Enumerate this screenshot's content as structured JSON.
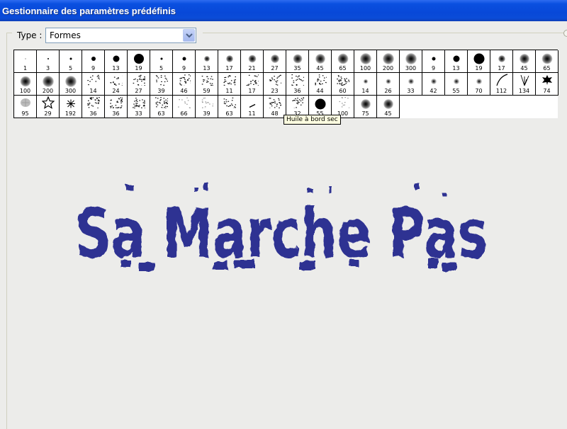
{
  "window": {
    "title": "Gestionnaire des paramètres prédéfinis"
  },
  "type_selector": {
    "label": "Type :",
    "value": "Formes"
  },
  "tooltip": "Huile à bord sec",
  "colors": {
    "title_bar": "#0A50E0",
    "art_blue": "#2E3192"
  },
  "art_text": "Sa Marche Pas",
  "brushes": [
    {
      "size": "1",
      "kind": "hard",
      "d": 1
    },
    {
      "size": "3",
      "kind": "hard",
      "d": 2
    },
    {
      "size": "5",
      "kind": "hard",
      "d": 3
    },
    {
      "size": "9",
      "kind": "hard",
      "d": 6
    },
    {
      "size": "13",
      "kind": "hard",
      "d": 9
    },
    {
      "size": "19",
      "kind": "hard",
      "d": 14
    },
    {
      "size": "5",
      "kind": "hard",
      "d": 3
    },
    {
      "size": "9",
      "kind": "hard",
      "d": 5
    },
    {
      "size": "13",
      "kind": "soft",
      "d": 6
    },
    {
      "size": "17",
      "kind": "soft",
      "d": 8
    },
    {
      "size": "21",
      "kind": "soft",
      "d": 9
    },
    {
      "size": "27",
      "kind": "soft",
      "d": 10
    },
    {
      "size": "35",
      "kind": "soft",
      "d": 11
    },
    {
      "size": "45",
      "kind": "soft",
      "d": 12
    },
    {
      "size": "65",
      "kind": "soft",
      "d": 13
    },
    {
      "size": "100",
      "kind": "soft",
      "d": 14
    },
    {
      "size": "200",
      "kind": "soft",
      "d": 14
    },
    {
      "size": "300",
      "kind": "soft",
      "d": 14
    },
    {
      "size": "9",
      "kind": "hard",
      "d": 5
    },
    {
      "size": "13",
      "kind": "hard",
      "d": 9
    },
    {
      "size": "19",
      "kind": "hard",
      "d": 15
    },
    {
      "size": "17",
      "kind": "soft",
      "d": 8
    },
    {
      "size": "45",
      "kind": "soft",
      "d": 12
    },
    {
      "size": "65",
      "kind": "soft",
      "d": 13
    },
    {
      "size": "100",
      "kind": "soft",
      "d": 13
    },
    {
      "size": "200",
      "kind": "soft",
      "d": 14
    },
    {
      "size": "300",
      "kind": "soft",
      "d": 14
    },
    {
      "size": "14",
      "kind": "splat",
      "d": 10
    },
    {
      "size": "24",
      "kind": "splat",
      "d": 14
    },
    {
      "size": "27",
      "kind": "splat",
      "d": 15
    },
    {
      "size": "39",
      "kind": "splat",
      "d": 15
    },
    {
      "size": "46",
      "kind": "splat",
      "d": 15
    },
    {
      "size": "59",
      "kind": "splat",
      "d": 15
    },
    {
      "size": "11",
      "kind": "splat",
      "d": 9
    },
    {
      "size": "17",
      "kind": "splat",
      "d": 13
    },
    {
      "size": "23",
      "kind": "splat",
      "d": 15
    },
    {
      "size": "36",
      "kind": "splat",
      "d": 16
    },
    {
      "size": "44",
      "kind": "hatch",
      "d": 16
    },
    {
      "size": "60",
      "kind": "hatch",
      "d": 15
    },
    {
      "size": "14",
      "kind": "spark",
      "d": 4
    },
    {
      "size": "26",
      "kind": "spark",
      "d": 5
    },
    {
      "size": "33",
      "kind": "spark",
      "d": 6
    },
    {
      "size": "42",
      "kind": "spark",
      "d": 6
    },
    {
      "size": "55",
      "kind": "spark",
      "d": 6
    },
    {
      "size": "70",
      "kind": "spark",
      "d": 6
    },
    {
      "size": "112",
      "kind": "curve",
      "d": 16
    },
    {
      "size": "134",
      "kind": "grass",
      "d": 16
    },
    {
      "size": "74",
      "kind": "leaf",
      "d": 14
    },
    {
      "size": "95",
      "kind": "leafpale",
      "d": 14
    },
    {
      "size": "29",
      "kind": "star",
      "d": 16
    },
    {
      "size": "192",
      "kind": "starburst",
      "d": 12
    },
    {
      "size": "36",
      "kind": "hatch",
      "d": 16
    },
    {
      "size": "36",
      "kind": "hatch",
      "d": 16
    },
    {
      "size": "33",
      "kind": "hatch",
      "d": 16
    },
    {
      "size": "63",
      "kind": "hatch",
      "d": 16
    },
    {
      "size": "66",
      "kind": "texture",
      "d": 14
    },
    {
      "size": "39",
      "kind": "texture",
      "d": 14
    },
    {
      "size": "63",
      "kind": "splat",
      "d": 13
    },
    {
      "size": "11",
      "kind": "stroke",
      "d": 8
    },
    {
      "size": "48",
      "kind": "hatch",
      "d": 16
    },
    {
      "size": "32",
      "kind": "splat",
      "d": 15
    },
    {
      "size": "55",
      "kind": "hard",
      "d": 15
    },
    {
      "size": "100",
      "kind": "texture",
      "d": 14
    },
    {
      "size": "75",
      "kind": "soft",
      "d": 12
    },
    {
      "size": "45",
      "kind": "soft",
      "d": 12
    }
  ]
}
